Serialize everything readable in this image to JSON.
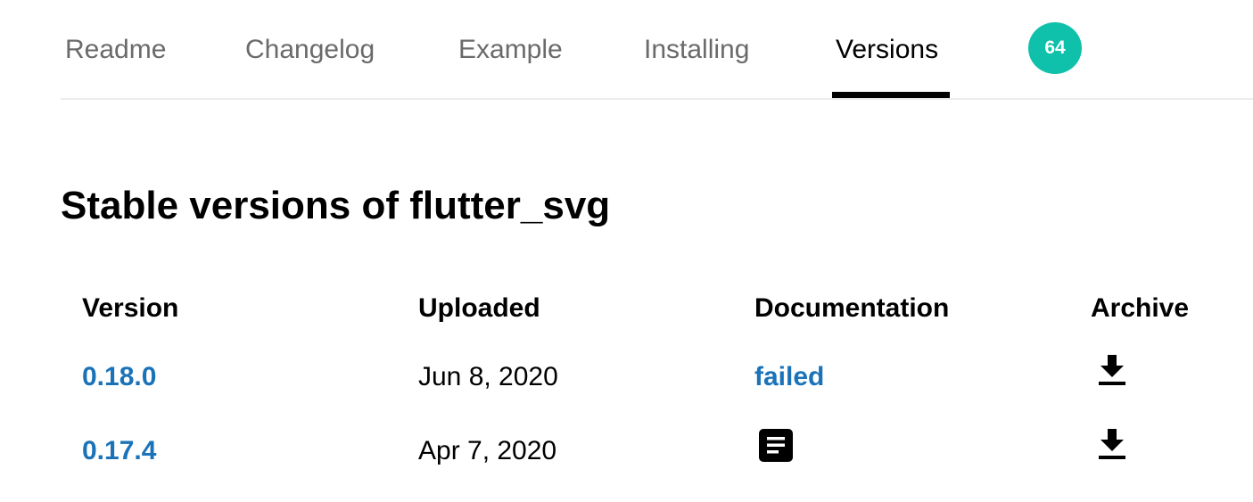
{
  "tabs": [
    {
      "label": "Readme"
    },
    {
      "label": "Changelog"
    },
    {
      "label": "Example"
    },
    {
      "label": "Installing"
    },
    {
      "label": "Versions"
    }
  ],
  "active_tab": "Versions",
  "score_badge": "64",
  "page_title": "Stable versions of flutter_svg",
  "table": {
    "headers": [
      "Version",
      "Uploaded",
      "Documentation",
      "Archive"
    ],
    "rows": [
      {
        "version": "0.18.0",
        "uploaded": "Jun 8, 2020",
        "documentation": "failed",
        "documentation_icon": null,
        "archive_icon": "download-icon"
      },
      {
        "version": "0.17.4",
        "uploaded": "Apr 7, 2020",
        "documentation": "",
        "documentation_icon": "document-icon",
        "archive_icon": "download-icon"
      }
    ]
  },
  "colors": {
    "link": "#1a73b8",
    "badge": "#0fc0ab",
    "tab_inactive": "#6a6a6a",
    "tab_active": "#000000"
  }
}
